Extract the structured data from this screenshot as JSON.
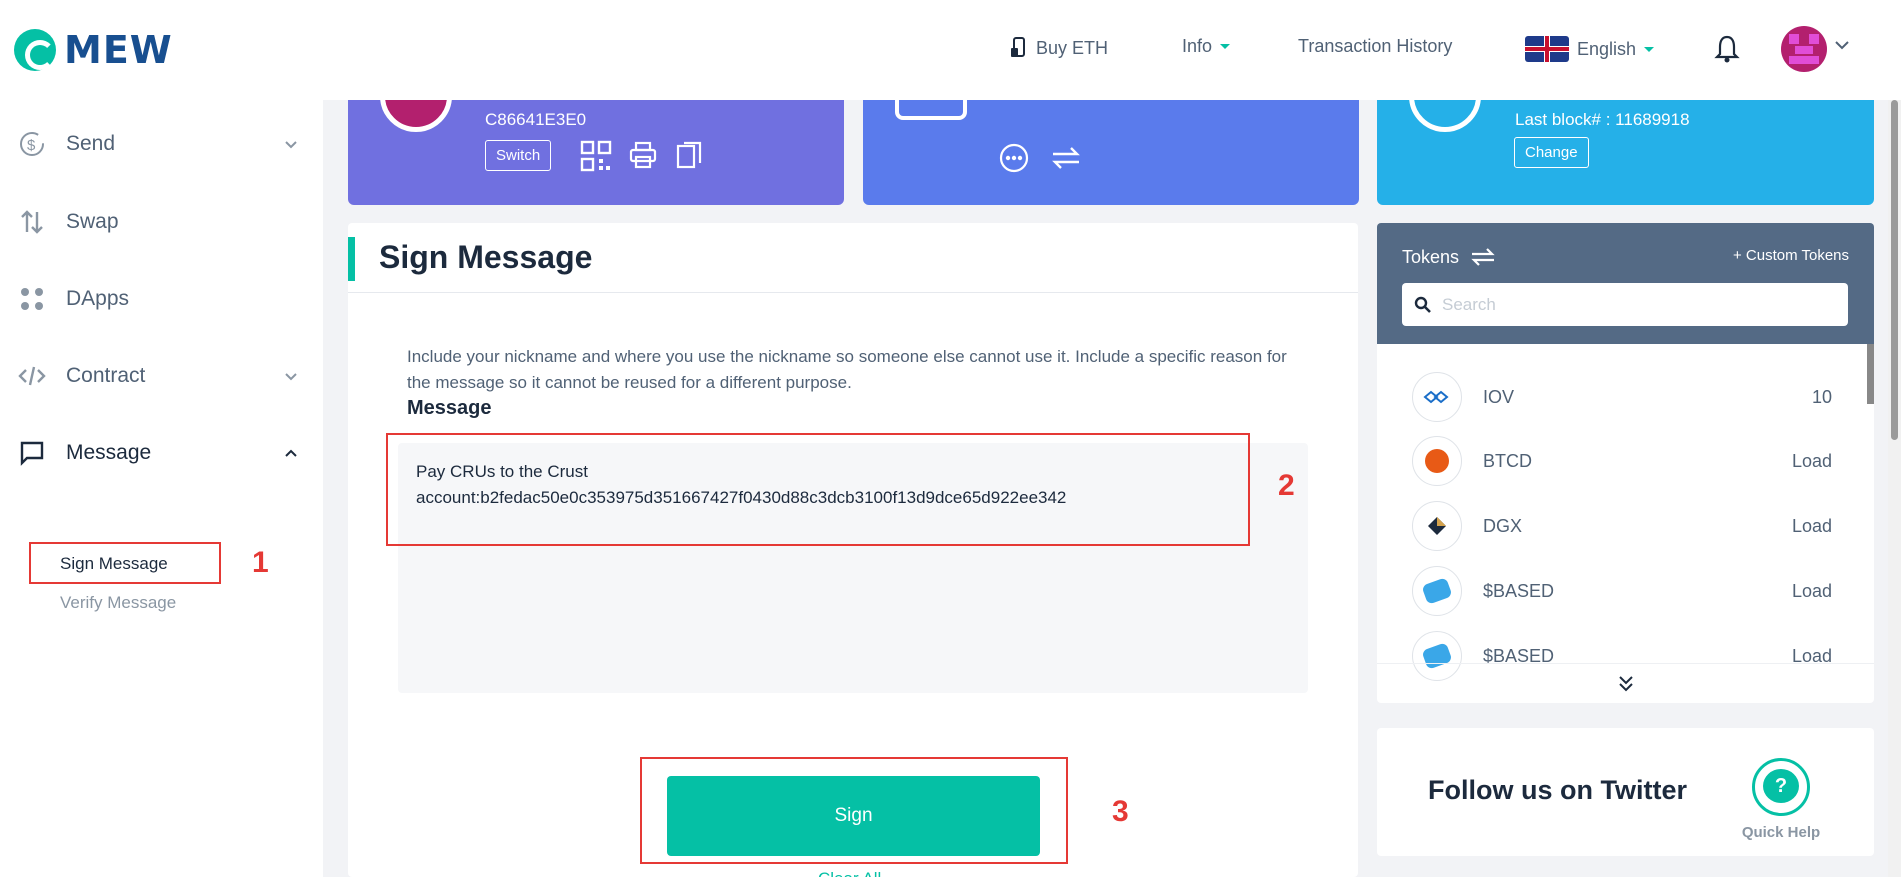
{
  "header": {
    "logo_text": "MEW",
    "nav": {
      "buy_eth": "Buy ETH",
      "info": "Info",
      "transaction_history": "Transaction History",
      "language": "English"
    }
  },
  "sidebar": {
    "items": [
      {
        "label": "Send",
        "icon": "send-icon",
        "expandable": true
      },
      {
        "label": "Swap",
        "icon": "swap-icon",
        "expandable": false
      },
      {
        "label": "DApps",
        "icon": "dapps-icon",
        "expandable": false
      },
      {
        "label": "Contract",
        "icon": "contract-icon",
        "expandable": true
      },
      {
        "label": "Message",
        "icon": "message-icon",
        "expandable": true,
        "expanded": true
      }
    ],
    "message_subitems": [
      "Sign Message",
      "Verify Message"
    ]
  },
  "top_cards": {
    "address": {
      "address_fragment": "C86641E3E0",
      "switch_label": "Switch",
      "color": "#7070e0"
    },
    "balance": {
      "color": "#5a7bec"
    },
    "network": {
      "last_block": "Last block# : 11689918",
      "change_label": "Change",
      "color": "#25b0e8"
    }
  },
  "sign_message": {
    "title": "Sign Message",
    "description": "Include your nickname and where you use the nickname so someone else cannot use it. Include a specific reason for the message so it cannot be reused for a different purpose.",
    "message_label": "Message",
    "message_line1": "Pay CRUs to the Crust",
    "message_line2": "account:b2fedac50e0c353975d351667427f0430d88c3dcb3100f13d9dce65d922ee342",
    "sign_button": "Sign",
    "clear_all": "Clear All"
  },
  "annotations": [
    "1",
    "2",
    "3"
  ],
  "tokens": {
    "title": "Tokens",
    "custom_tokens": "+ Custom Tokens",
    "search_placeholder": "Search",
    "list": [
      {
        "name": "IOV",
        "value": "10"
      },
      {
        "name": "BTCD",
        "value": "Load"
      },
      {
        "name": "DGX",
        "value": "Load"
      },
      {
        "name": "$BASED",
        "value": "Load"
      },
      {
        "name": "$BASED",
        "value": "Load"
      }
    ]
  },
  "twitter": {
    "text": "Follow us on Twitter"
  },
  "quick_help": {
    "label": "Quick Help"
  },
  "colors": {
    "accent": "#05c0a5",
    "annotation": "#e53935"
  }
}
